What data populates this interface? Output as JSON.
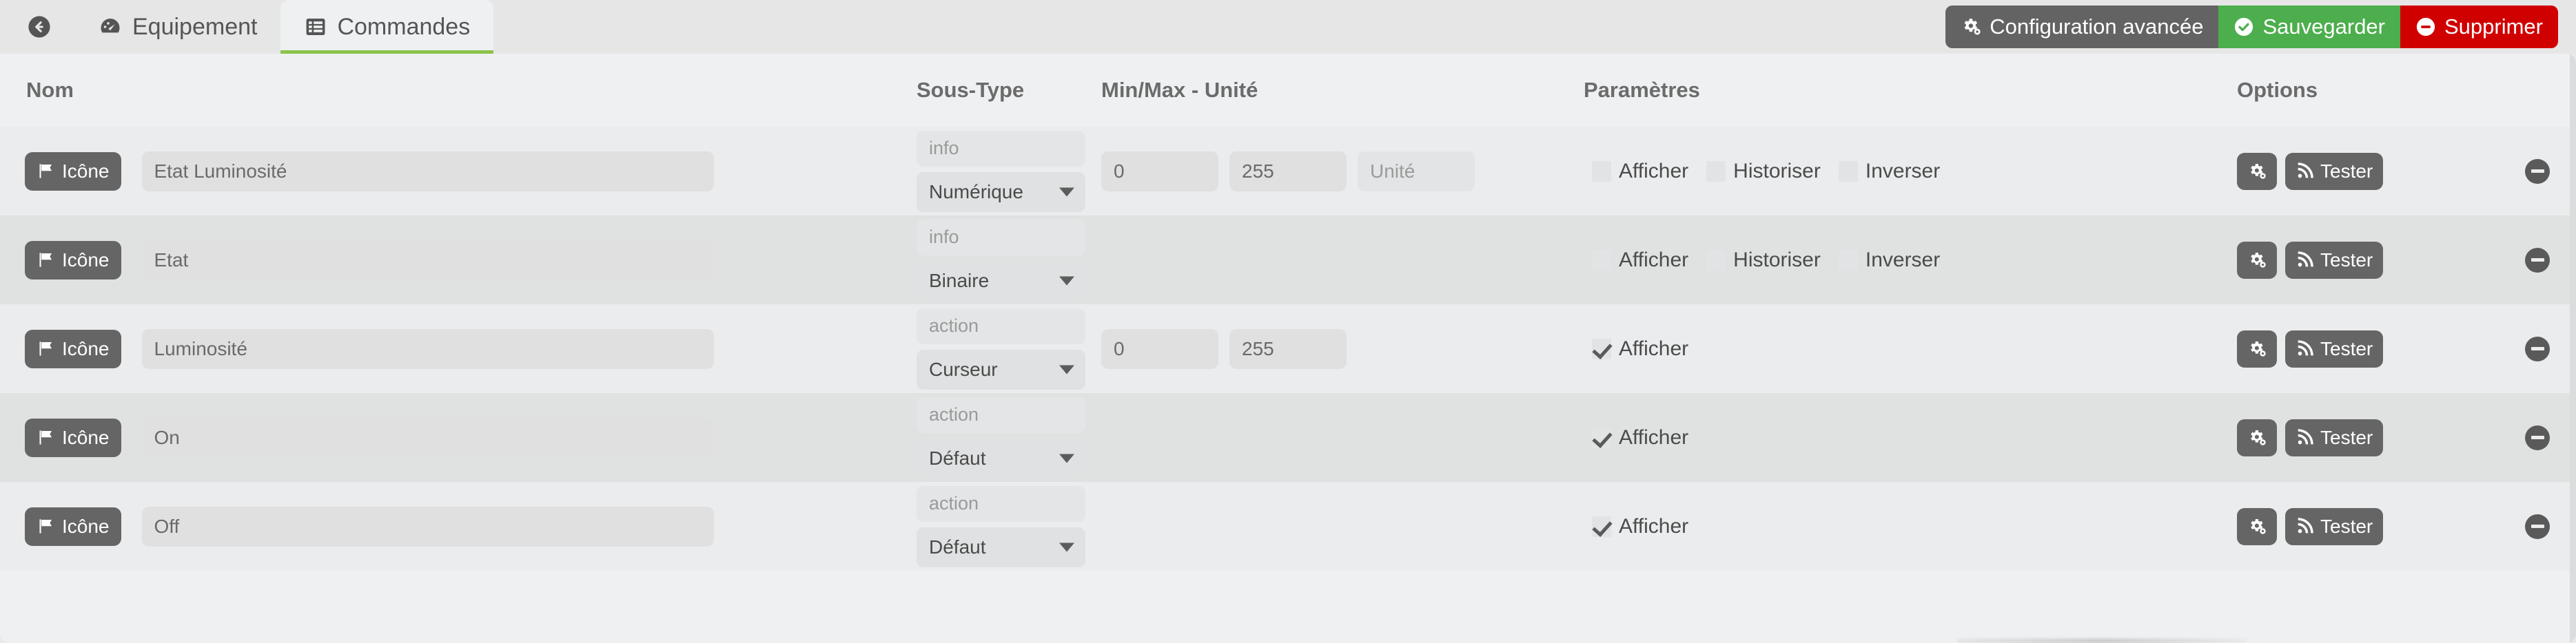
{
  "tabs": [
    {
      "id": "back",
      "label": "",
      "icon": "arrow-left-circle-icon",
      "active": false
    },
    {
      "id": "equipement",
      "label": "Equipement",
      "icon": "dashboard-icon",
      "active": false
    },
    {
      "id": "commandes",
      "label": "Commandes",
      "icon": "list-table-icon",
      "active": true
    }
  ],
  "toolbar": {
    "advanced_label": "Configuration avancée",
    "advanced_icon": "gears-icon",
    "save_label": "Sauvegarder",
    "save_icon": "check-circle-icon",
    "delete_label": "Supprimer",
    "delete_icon": "minus-circle-icon",
    "colors": {
      "advanced": "#636363",
      "save": "#4cae4c",
      "delete": "#d10000",
      "active_tab_underline": "#8bc34a"
    }
  },
  "table": {
    "headers": {
      "nom": "Nom",
      "sous_type": "Sous-Type",
      "min_max_unite": "Min/Max - Unité",
      "parametres": "Paramètres",
      "options": "Options"
    },
    "icon_button_label": "Icône",
    "icon_button_icon": "flag-icon",
    "config_button_icon": "gears-icon",
    "test_button_label": "Tester",
    "test_button_icon": "rss-signal-icon",
    "remove_button_icon": "minus-circle-icon",
    "unit_placeholder": "Unité",
    "rows": [
      {
        "name": "Etat Luminosité",
        "type_placeholder": "info",
        "subtype": "Numérique",
        "subtype_options": [
          "Numérique",
          "Binaire",
          "Curseur",
          "Défaut"
        ],
        "min": "0",
        "max": "255",
        "unit": "",
        "has_minmax": true,
        "has_unit": true,
        "params": [
          {
            "label": "Afficher",
            "checked": false
          },
          {
            "label": "Historiser",
            "checked": false
          },
          {
            "label": "Inverser",
            "checked": false
          }
        ]
      },
      {
        "name": "Etat",
        "type_placeholder": "info",
        "subtype": "Binaire",
        "subtype_options": [
          "Numérique",
          "Binaire",
          "Curseur",
          "Défaut"
        ],
        "min": "",
        "max": "",
        "unit": "",
        "has_minmax": false,
        "has_unit": false,
        "params": [
          {
            "label": "Afficher",
            "checked": false
          },
          {
            "label": "Historiser",
            "checked": false
          },
          {
            "label": "Inverser",
            "checked": false
          }
        ]
      },
      {
        "name": "Luminosité",
        "type_placeholder": "action",
        "subtype": "Curseur",
        "subtype_options": [
          "Numérique",
          "Binaire",
          "Curseur",
          "Défaut"
        ],
        "min": "0",
        "max": "255",
        "unit": "",
        "has_minmax": true,
        "has_unit": false,
        "params": [
          {
            "label": "Afficher",
            "checked": true
          }
        ]
      },
      {
        "name": "On",
        "type_placeholder": "action",
        "subtype": "Défaut",
        "subtype_options": [
          "Numérique",
          "Binaire",
          "Curseur",
          "Défaut"
        ],
        "min": "",
        "max": "",
        "unit": "",
        "has_minmax": false,
        "has_unit": false,
        "params": [
          {
            "label": "Afficher",
            "checked": true
          }
        ]
      },
      {
        "name": "Off",
        "type_placeholder": "action",
        "subtype": "Défaut",
        "subtype_options": [
          "Numérique",
          "Binaire",
          "Curseur",
          "Défaut"
        ],
        "min": "",
        "max": "",
        "unit": "",
        "has_minmax": false,
        "has_unit": false,
        "params": [
          {
            "label": "Afficher",
            "checked": true
          }
        ]
      }
    ]
  }
}
